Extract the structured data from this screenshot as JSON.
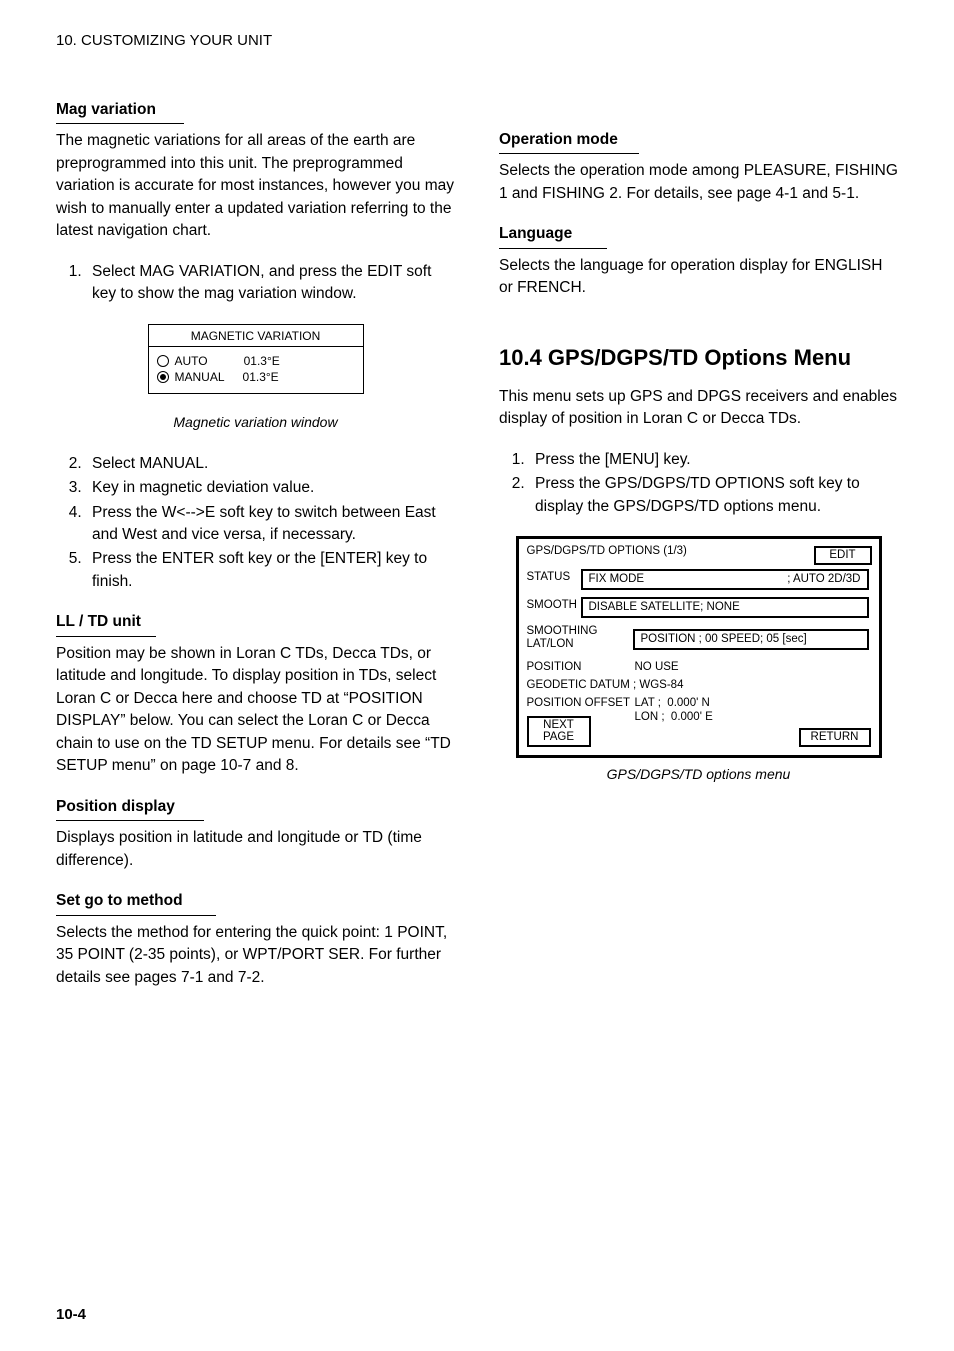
{
  "header": {
    "text": "10. CUSTOMIZING YOUR UNIT"
  },
  "left": {
    "magvar": {
      "title": "Mag variation",
      "p1": "The magnetic variations for all areas of the earth are preprogrammed into this unit. The preprogrammed variation is accurate for most instances, however you may wish to manually enter a updated variation referring to the latest navigation chart.",
      "step1": "Select MAG VARIATION, and press the EDIT soft key to show the mag variation window.",
      "win": {
        "title": "MAGNETIC VARIATION",
        "autoLabel": "AUTO",
        "autoVal": "01.3°E",
        "manualLabel": "MANUAL",
        "manualVal": "01.3°E"
      },
      "caption": "Magnetic variation window",
      "step2": "Select MANUAL.",
      "step3": "Key in magnetic deviation value.",
      "step4": "Press the W<-->E soft key to switch between East and West and vice versa, if necessary.",
      "step5": "Press the ENTER soft key or the [ENTER] key to finish."
    },
    "lltd": {
      "title": "LL / TD unit",
      "p": "Position may be shown in Loran C TDs, Decca TDs, or latitude and longitude. To display position in TDs, select Loran C or Decca here and choose TD at “POSITION DISPLAY” below. You can select the Loran C or Decca chain to use on the TD SETUP menu. For details see “TD SETUP menu” on page 10-7 and 8."
    },
    "posdisp": {
      "title": "Position display",
      "p": "Displays position in latitude and longitude or TD (time difference)."
    },
    "setgoto": {
      "title": "Set go to method",
      "p": "Selects the method for entering the quick point: 1 POINT, 35 POINT (2-35 points), or WPT/PORT SER. For further details see pages 7-1 and 7-2."
    }
  },
  "right": {
    "opmode": {
      "title": "Operation mode",
      "p": "Selects the operation mode among PLEASURE, FISHING 1 and FISHING 2. For details, see page 4-1 and 5-1."
    },
    "lang": {
      "title": "Language",
      "p": "Selects the language for operation display for ENGLISH or FRENCH."
    },
    "gpstitle": "10.4 GPS/DGPS/TD Options Menu",
    "gpsintro": "This menu sets up GPS and DPGS receivers and enables display of position in Loran C or Decca TDs.",
    "gpss1": "Press the [MENU] key.",
    "gpss2": "Press the GPS/DGPS/TD OPTIONS soft key to display the GPS/DGPS/TD options menu.",
    "menu": {
      "title": "GPS/DGPS/TD OPTIONS (1/3)",
      "edit": "EDIT",
      "leftStat": "STATUS",
      "fix": "FIX MODE",
      "fixVal": "; AUTO 2D/3D",
      "smooth": "SMOOTH",
      "disable": "DISABLE SATELLITE; NONE",
      "smoothing": "SMOOTHING",
      "latlon": "LAT/LON",
      "posSpd": "POSITION ; 00  SPEED; 05 [sec]",
      "tdLabel": "POSITION",
      "tdVal": "NO USE",
      "geod": "GEODETIC DATUM  ; WGS-84",
      "pos": "POSITION OFFSET",
      "posVal": "LAT ;  0.000' N",
      "lonVal": "LON ;  0.000' E",
      "next": "NEXT PAGE",
      "ret": "RETURN"
    },
    "menucap": "GPS/DGPS/TD options menu"
  },
  "footer": "10-4"
}
